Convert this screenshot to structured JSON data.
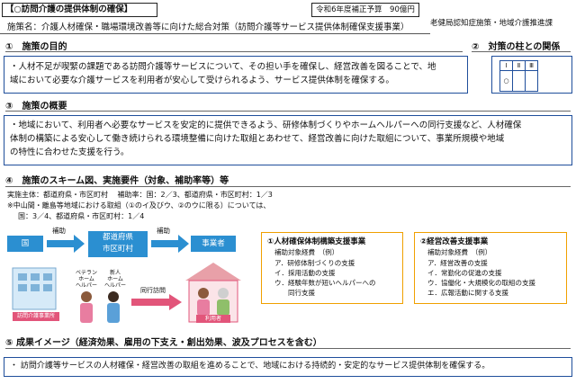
{
  "header": {
    "title": "【○訪問介護の提供体制の確保】",
    "budget": "令和6年度補正予算　90億円",
    "department": "老健局認知症施策・地域介護推進課",
    "measure": "施策名：介護人材確保・職場環境改善等に向けた総合対策（訪問介護等サービス提供体制確保支援事業）"
  },
  "purpose": {
    "heading": "①　施策の目的",
    "text_line1": "・人材不足が喫緊の課題である訪問介護等サービスについて、その担い手を確保し、経営改善を図ることで、地",
    "text_line2": "域において必要な介護サービスを利用者が安心して受けられるよう、サービス提供体制を確保する。"
  },
  "pillars": {
    "heading": "②　対策の柱との関係",
    "headers": [
      "Ⅰ",
      "Ⅱ",
      "Ⅲ"
    ],
    "marks": [
      "○",
      "",
      ""
    ]
  },
  "overview": {
    "heading": "③　施策の概要",
    "line1": "・地域において、利用者へ必要なサービスを安定的に提供できるよう、研修体制づくりやホームヘルパーへの同行支援など、人材確保",
    "line2": "体制の構築による安心して働き続けられる環境整備に向けた取組とあわせて、経営改善に向けた取組について、事業所規模や地域",
    "line3": "の特性に合わせた支援を行う。"
  },
  "scheme": {
    "heading": "④　施策のスキーム図、実施要件（対象、補助率等）等",
    "line1": "実施主体：都道府県・市区町村　 補助率：国：2／3、都道府県・市区町村：1／3",
    "line2": "※中山間・離島等地域における取組（①のイ及びウ、②のウに限る）については、",
    "line3": "国：3／4、都道府県・市区町村：1／4",
    "flow": {
      "country": "国",
      "subsidy1": "補助",
      "prefecture_line1": "都道府県",
      "prefecture_line2": "市区町村",
      "subsidy2": "補助",
      "operator": "事業者",
      "office_label": "訪問介護事業所",
      "veteran_label1": "ベテラン",
      "veteran_label2": "ホーム",
      "veteran_label3": "ヘルパー",
      "new_label1": "新人",
      "new_label2": "ホーム",
      "new_label3": "ヘルパー",
      "accompany": "同行訪問",
      "user_label": "利用者"
    }
  },
  "support1": {
    "title": "①人材確保体制構築支援事業",
    "subtitle": "補助対象経費　（例）",
    "items": [
      "ア．研修体制づくりの支援",
      "イ．採用活動の支援",
      "ウ．経験年数が短いヘルパーへの",
      "　　同行支援"
    ]
  },
  "support2": {
    "title": "②経営改善支援事業",
    "subtitle": "補助対象経費　（例）",
    "items": [
      "ア．経営改善の支援",
      "イ．常勤化の促進の支援",
      "ウ．協働化・大規模化の取組の支援",
      "エ．広報活動に関する支援"
    ]
  },
  "outcome": {
    "heading": "⑤ 成果イメージ（経済効果、雇用の下支え・創出効果、波及プロセスを含む）",
    "text": "・ 訪問介護等サービスの人材確保・経営改善の取組を進めることで、地域における持続的・安定的なサービス提供体制を確保する。"
  }
}
